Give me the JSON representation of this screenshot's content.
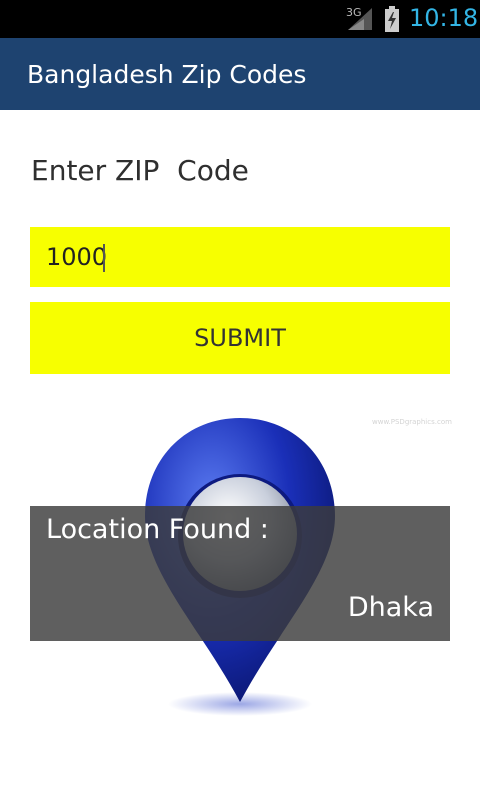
{
  "status_bar": {
    "network": "3G",
    "time": "10:18",
    "icons": [
      "signal-icon",
      "battery-charging-icon"
    ]
  },
  "app": {
    "title": "Bangladesh Zip Codes"
  },
  "form": {
    "prompt": "Enter ZIP  Code",
    "zip_value": "1000",
    "submit_label": "SUBMIT"
  },
  "watermark": "www.PSDgraphics.com",
  "result": {
    "label": "Location Found :",
    "value": "Dhaka"
  },
  "colors": {
    "action_bar": "#1e4370",
    "input_bg": "#f7ff00",
    "clock": "#33b5e5",
    "pin": "#1a2fb8"
  }
}
